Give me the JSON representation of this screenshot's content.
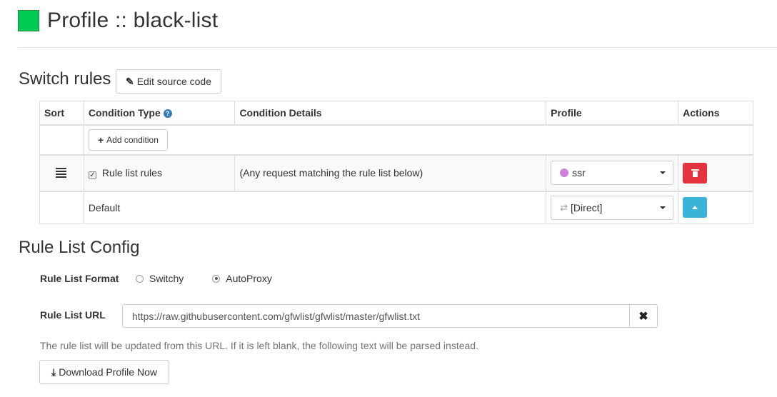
{
  "header": {
    "title": "Profile :: black-list",
    "swatch_color": "#00cc55"
  },
  "switch_rules": {
    "title": "Switch rules",
    "edit_button": {
      "icon": "edit-icon",
      "label": "Edit source code"
    },
    "columns": [
      "Sort",
      "Condition Type",
      "Condition Details",
      "Profile",
      "Actions"
    ],
    "add_condition": {
      "icon": "plus-icon",
      "label": "Add condition"
    },
    "rules": [
      {
        "condition_type": "Rule list rules",
        "checked": true,
        "details": "(Any request matching the rule list below)",
        "profile": "ssr",
        "profile_icon": "globe-icon",
        "action": "delete"
      }
    ],
    "default_row": {
      "label": "Default",
      "profile": "[Direct]",
      "profile_icon": "exchange-icon",
      "action": "move-up"
    }
  },
  "rule_list_config": {
    "title": "Rule List Config",
    "format_label": "Rule List Format",
    "formats": [
      {
        "label": "Switchy",
        "selected": false
      },
      {
        "label": "AutoProxy",
        "selected": true
      }
    ],
    "url_label": "Rule List URL",
    "url_value": "https://raw.githubusercontent.com/gfwlist/gfwlist/master/gfwlist.txt",
    "help_text": "The rule list will be updated from this URL. If it is left blank, the following text will be parsed instead.",
    "download_button": {
      "icon": "download-icon",
      "label": "Download Profile Now"
    }
  },
  "colors": {
    "danger": "#e5323f",
    "info": "#39b3d7",
    "link": "#337ab7"
  }
}
